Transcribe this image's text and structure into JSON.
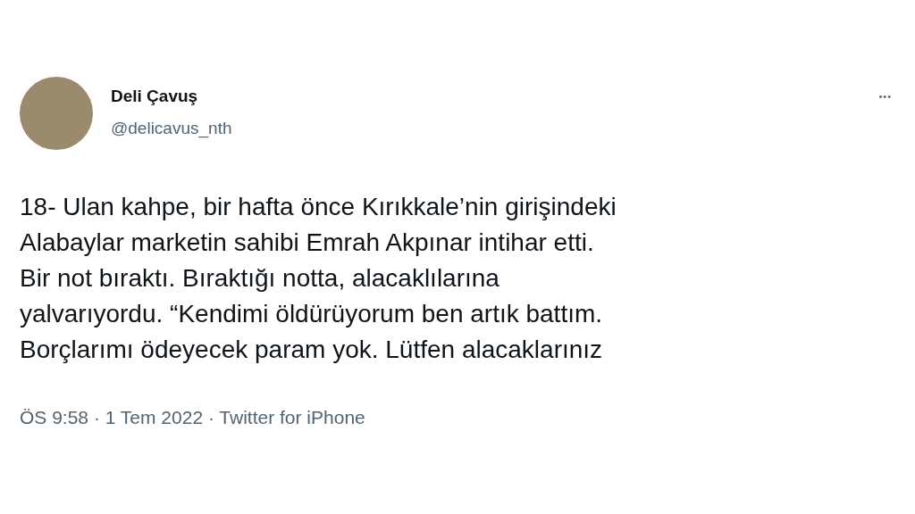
{
  "tweet": {
    "author": {
      "name": "Deli Çavuş",
      "handle": "@delicavus_nth"
    },
    "more": "•••",
    "text_lines": [
      "18- Ulan kahpe, bir hafta önce Kırıkkale’nin girişindeki",
      "Alabaylar marketin sahibi Emrah Akpınar intihar etti.",
      "Bir not bıraktı. Bıraktığı notta, alacaklılarına",
      "yalvarıyordu. “Kendimi öldürüyorum ben artık battım.",
      "Borçlarımı ödeyecek param yok. Lütfen alacaklarınız"
    ],
    "meta": "ÖS 9:58 · 1 Tem 2022 · Twitter for iPhone"
  }
}
